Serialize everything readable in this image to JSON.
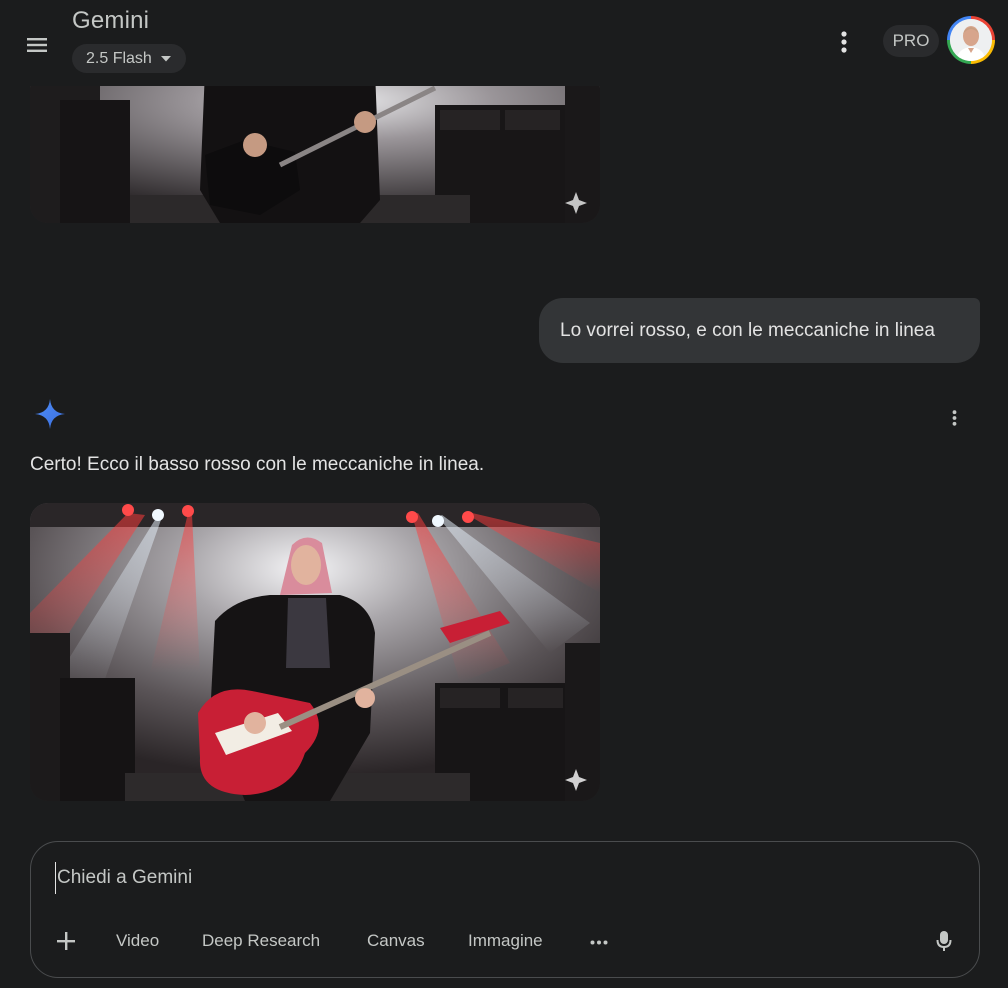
{
  "header": {
    "app_title": "Gemini",
    "model_selector": {
      "label": "2.5 Flash"
    },
    "pro_badge": "PRO",
    "icons": {
      "menu": "menu-icon",
      "more": "more-vert-icon",
      "avatar": "avatar"
    }
  },
  "conversation": {
    "user_message": "Lo vorrei rosso, e con le meccaniche in linea",
    "response": {
      "icon": "gemini-spark-icon",
      "text": "Certo! Ecco il basso rosso con le meccaniche in linea."
    },
    "images": [
      {
        "description": "previous-generated-image"
      },
      {
        "description": "generated-image-red-bass"
      }
    ]
  },
  "composer": {
    "placeholder": "Chiedi a Gemini",
    "value": "",
    "tools": [
      "Video",
      "Deep Research",
      "Canvas",
      "Immagine"
    ],
    "icons": {
      "add": "plus-icon",
      "more": "more-horiz-icon",
      "mic": "mic-icon"
    }
  },
  "colors": {
    "background": "#1b1c1d",
    "bubble": "#333537",
    "chip": "#2a2b2d",
    "text": "#e3e3e3",
    "muted_text": "#c4c7c5",
    "gemini_blue": "#4285f4"
  }
}
